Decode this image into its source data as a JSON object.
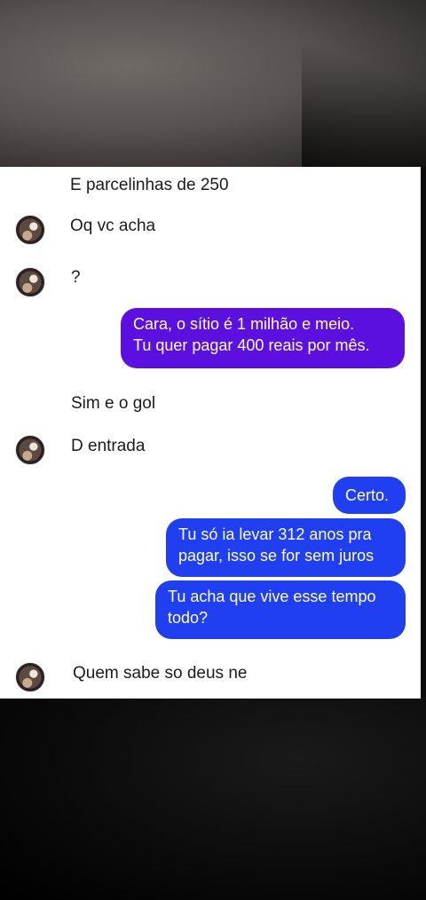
{
  "messages": {
    "m1": "E parcelinhas de 250",
    "m2": "Oq vc acha",
    "m3": "?",
    "m4_line1": "Cara, o sítio  é 1 milhão e meio.",
    "m4_line2": "Tu quer pagar 400 reais por mês.",
    "m5": "Sim e o gol",
    "m6": "D entrada",
    "m7": "Certo.",
    "m8_line1": "Tu só ia levar 312 anos pra",
    "m8_line2": "pagar, isso se for sem juros",
    "m9_line1": "Tu acha que vive esse tempo",
    "m9_line2": "todo?",
    "m10": "Quem sabe so deus ne"
  },
  "colors": {
    "sent_purple": "#5b10e0",
    "sent_blue": "#1f3ff0",
    "chat_background": "#ffffff"
  }
}
